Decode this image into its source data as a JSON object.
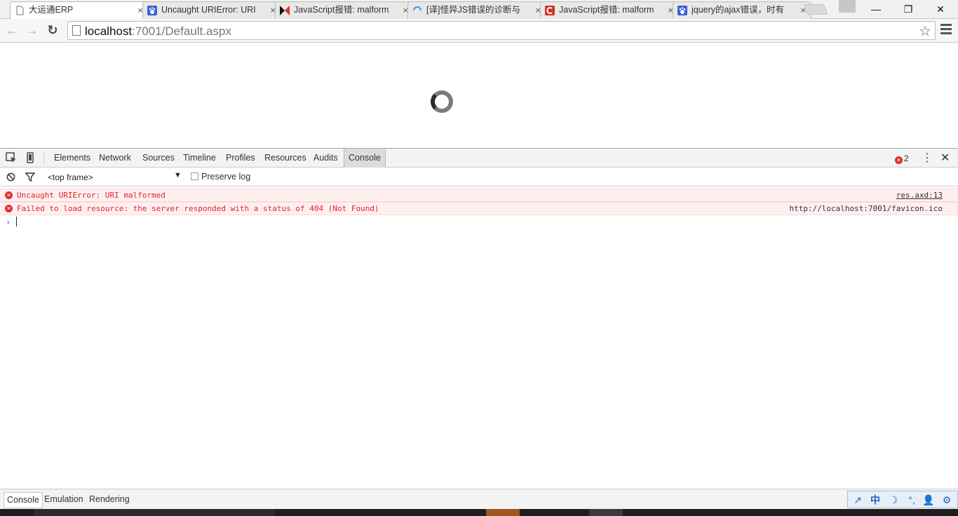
{
  "tabs": [
    {
      "title": "大运通ERP",
      "icon": "page-icon",
      "active": true
    },
    {
      "title": "Uncaught URIError: URI",
      "icon": "baidu-paw-icon",
      "active": false
    },
    {
      "title": "JavaScript报错: malform",
      "icon": "bowtie-icon",
      "active": false
    },
    {
      "title": "[译]怪异JS错误的诊断与",
      "icon": "loading-spinner-icon",
      "active": false
    },
    {
      "title": "JavaScript报错: malform",
      "icon": "csdn-c-icon",
      "active": false
    },
    {
      "title": "jquery的ajax错误，时有",
      "icon": "baidu-paw-icon",
      "active": false
    }
  ],
  "tab_close_glyph": "×",
  "window": {
    "minimize": "—",
    "maximize": "❐",
    "close": "✕"
  },
  "toolbar": {
    "back": "←",
    "forward": "→",
    "reload": "↻",
    "url_host": "localhost",
    "url_rest": ":7001/Default.aspx",
    "star": "☆"
  },
  "devtools": {
    "tabs": [
      "Elements",
      "Network",
      "Sources",
      "Timeline",
      "Profiles",
      "Resources",
      "Audits",
      "Console"
    ],
    "active_tab": "Console",
    "error_count": "2",
    "kebab": "⋮",
    "close": "✕",
    "frame_selector": "<top frame>",
    "frame_arrow": "▼",
    "preserve_log": "Preserve log",
    "messages": [
      {
        "text": "Uncaught URIError: URI malformed",
        "source": "res.axd:13",
        "underline": true
      },
      {
        "text": "Failed to load resource: the server responded with a status of 404 (Not Found)",
        "source": "http://localhost:7001/favicon.ico",
        "underline": false
      }
    ],
    "error_glyph": "✕",
    "prompt": "›",
    "drawer_tabs": [
      "Console",
      "Emulation",
      "Rendering"
    ],
    "drawer_active": "Console"
  },
  "ime": {
    "items": [
      "↗",
      "中",
      "☽",
      "°,",
      "👤",
      "⚙"
    ]
  },
  "colors": {
    "error_red": "#e02424",
    "error_bg": "#fff0f0",
    "accent_blue": "#2a6bd6"
  }
}
